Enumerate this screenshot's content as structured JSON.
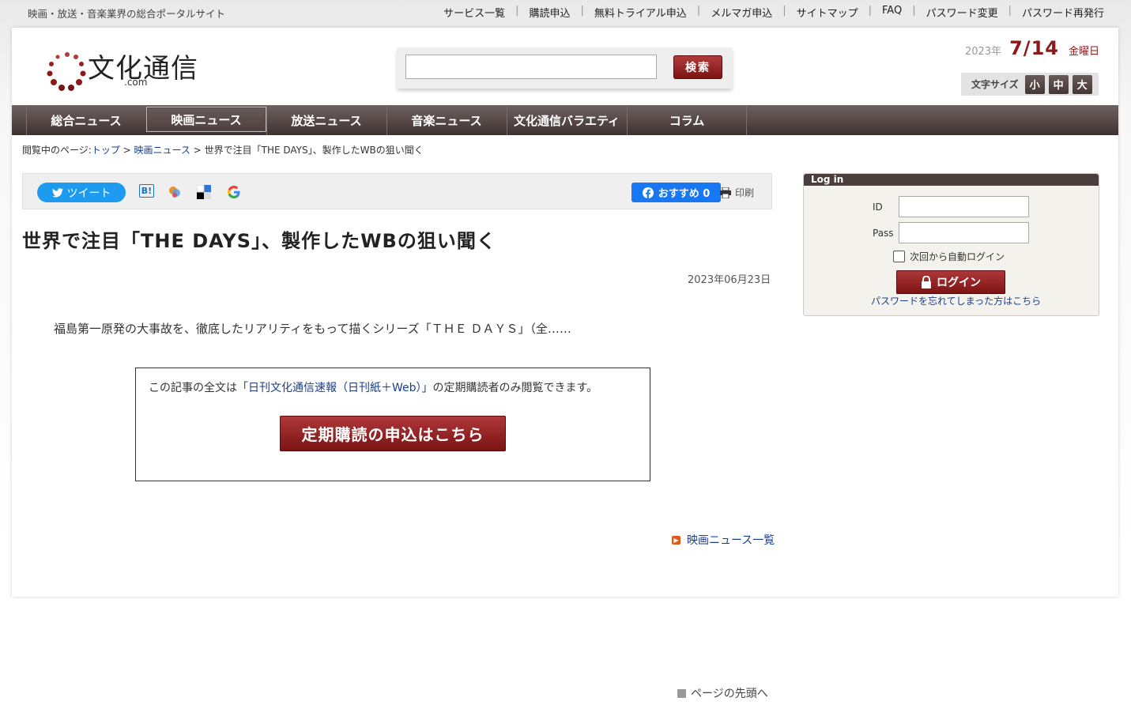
{
  "topbar": {
    "tagline": "映画・放送・音楽業界の総合ポータルサイト",
    "links": [
      "サービス一覧",
      "購読申込",
      "無料トライアル申込",
      "メルマガ申込",
      "サイトマップ",
      "FAQ",
      "パスワード変更",
      "パスワード再発行"
    ],
    "separator": "|"
  },
  "header": {
    "logo_text": "文化通信",
    "logo_sub": ".com",
    "search": {
      "value": "",
      "button_label": "検索"
    },
    "date": {
      "year": "2023年",
      "month_day": "7/14",
      "weekday": "金曜日"
    },
    "font_size": {
      "label": "文字サイズ",
      "options": [
        "小",
        "中",
        "大"
      ]
    }
  },
  "nav": {
    "items": [
      "総合ニュース",
      "映画ニュース",
      "放送ニュース",
      "音楽ニュース",
      "文化通信バラエティ",
      "コラム"
    ],
    "active_index": 1
  },
  "breadcrumb": {
    "prefix": "閲覧中のページ:",
    "top": "トップ",
    "sep1": " > ",
    "category": "映画ニュース",
    "sep2": " > ",
    "current": "世界で注目「THE DAYS」、製作したWBの狙い聞く"
  },
  "social": {
    "tweet_label": "ツイート",
    "hatena_label": "B!",
    "facebook_label": "おすすめ 0",
    "print_label": "印刷",
    "icons": [
      "twitter-icon",
      "hatena-icon",
      "bookmark-icon",
      "delicious-icon",
      "google-icon",
      "facebook-icon",
      "printer-icon"
    ]
  },
  "article": {
    "title": "世界で注目「THE DAYS」、製作したWBの狙い聞く",
    "date": "2023年06月23日",
    "excerpt": "福島第一原発の大事故を、徹底したリアリティをもって描くシリーズ「ＴＨＥ ＤＡＹＳ」（全……",
    "notice_before": "この記事の全文は",
    "notice_link": "「日刊文化通信速報（日刊紙＋Web）」",
    "notice_after": "の定期購読者のみ閲覧できます。",
    "subscribe_button": "定期購読の申込はこちら",
    "list_link": "映画ニュース一覧"
  },
  "login": {
    "header": "Log in",
    "id_label": "ID",
    "pass_label": "Pass",
    "id_value": "",
    "pass_value": "",
    "auto_login_label": "次回から自動ログイン",
    "button_label": "ログイン",
    "forgot_link": "パスワードを忘れてしまった方はこちら"
  },
  "footer": {
    "page_top": "ページの先頭へ"
  },
  "colors": {
    "accent": "#8b1a1a",
    "nav_bg": "#4a3f3d",
    "link": "#1a3e8c",
    "twitter": "#1d9bf0",
    "facebook": "#1877f2"
  }
}
